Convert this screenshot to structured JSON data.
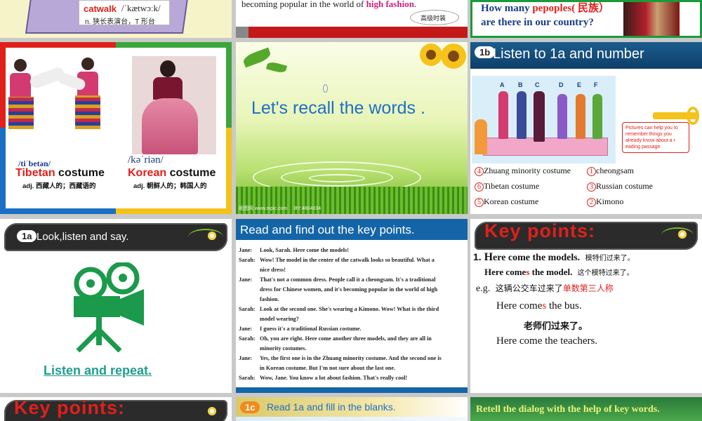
{
  "s1": {
    "word": "catwalk",
    "phon": "/ˈkætwɔːk/",
    "def": "n. 狭长表演台，T 形台"
  },
  "s2": {
    "text_before": "becoming popular in the world of ",
    "highlight": "high fashion",
    "text_after": ".",
    "tag": "高级时装"
  },
  "s3": {
    "q_a": "How many ",
    "q_red": "pepoples",
    "q_b": "( 民族）",
    "q_c": "are there in our country?"
  },
  "s4": {
    "left": {
      "phon": "/tiˈbetən/",
      "word_red": "Tibetan",
      "word_rest": " costume",
      "def": "adj. 西藏人的；西藏语的"
    },
    "right": {
      "phon": "/kəˈriən/",
      "word_red": "Korean",
      "word_rest": " costume",
      "def": "adj. 朝鲜人的；韩国人的"
    }
  },
  "s5": {
    "title": "Let's recall the words .",
    "watermark_a": "昵图网 www.nipic.com",
    "watermark_b": "BY:4804034"
  },
  "s6": {
    "badge": "1b",
    "title": "Listen to 1a and number",
    "letters": [
      "A",
      "B",
      "C",
      "D",
      "E",
      "F"
    ],
    "bubble": "Pictures can help you to remember things you already know about a r eading passage.",
    "items": [
      {
        "num": "4",
        "label": "Zhuang minority costume"
      },
      {
        "num": "1",
        "label": "cheongsam"
      },
      {
        "num": "6",
        "label": "Tibetan costume"
      },
      {
        "num": "3",
        "label": "Russian costume"
      },
      {
        "num": "5",
        "label": "Korean costume"
      },
      {
        "num": "2",
        "label": "Kimono"
      }
    ]
  },
  "s7": {
    "badge": "1a",
    "title": "Look,listen and say.",
    "link": "Listen and repeat."
  },
  "s8": {
    "title": "Read and find out the key points.",
    "lines": [
      {
        "sp": "Jane:",
        "t": "Look, Sarah. Here come the models!"
      },
      {
        "sp": "Sarah:",
        "t": "Wow! The model in the center of the catwalk looks so beautiful. What a"
      },
      {
        "sp": "",
        "t": "nice dress!"
      },
      {
        "sp": "Jane:",
        "t": "That's not a common dress. People call it a cheongsam. It's a traditional"
      },
      {
        "sp": "",
        "t": "dress for Chinese women, and it's becoming popular in the world of high"
      },
      {
        "sp": "",
        "t": "fashion."
      },
      {
        "sp": "Sarah:",
        "t": "Look at the second one. She's wearing a Kimono. Wow! What is the third"
      },
      {
        "sp": "",
        "t": "model wearing?"
      },
      {
        "sp": "Jane:",
        "t": "I guess it's a traditional Russian costume."
      },
      {
        "sp": "Sarah:",
        "t": "Oh, you are right. Here come another three models, and they are all in"
      },
      {
        "sp": "",
        "t": "minority costumes."
      },
      {
        "sp": "Jane:",
        "t": "Yes, the first one is in the Zhuang minority costume. And the second one is"
      },
      {
        "sp": "",
        "t": "in Korean costume. But I'm not sure about the last one."
      },
      {
        "sp": "Sarah:",
        "t": "Wow, Jane. You know a lot about fashion. That's really cool!"
      }
    ]
  },
  "s9": {
    "title": "Key points:",
    "l1_num": "1. ",
    "l1_a": "H",
    "l1_b": "ere come the models.",
    "l1_cn": "模特们过来了。",
    "l2_a": "Here come",
    "l2_red": "s",
    "l2_b": " the model.",
    "l2_cn": "这个模特过来了。",
    "l3_eg": "e.g.",
    "l3_cn": "这辆公交车过来了",
    "l3_red": "单数第三人称",
    "l4_a": "Here come",
    "l4_red": "s",
    "l4_b": " the bus.",
    "l5_cn": "老师们过来了。",
    "l6": "Here come the teachers."
  },
  "s10": {
    "title": "Key points:"
  },
  "s11": {
    "badge": "1c",
    "title": "Read 1a and fill in the blanks."
  },
  "s12": {
    "title": "Retell the dialog with the help of key words."
  },
  "colors": {
    "red": "#e0201b",
    "blue": "#1465a8",
    "teal": "#1f9e8d",
    "green": "#1a9a3a"
  }
}
